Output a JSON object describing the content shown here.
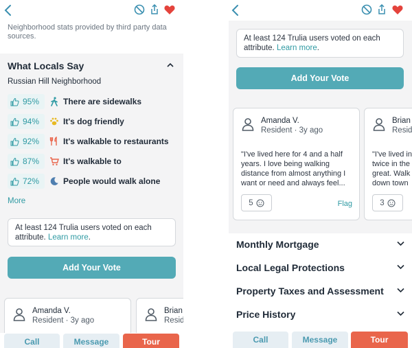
{
  "colors": {
    "teal": "#53aab6",
    "tour": "#e9654b",
    "heart": "#e4433c",
    "link": "#2f9aa3"
  },
  "left": {
    "header": {
      "back_icon": "chevron-left-icon",
      "icons": [
        "hide-icon",
        "share-icon",
        "heart-icon"
      ]
    },
    "stats_note": "Neighborhood stats provided by third party data sources.",
    "section_title": "What Locals Say",
    "neighborhood": "Russian Hill Neighborhood",
    "attributes": [
      {
        "percent": "95%",
        "label": "There are sidewalks",
        "icon": "walking-person-icon"
      },
      {
        "percent": "94%",
        "label": "It's dog friendly",
        "icon": "paw-icon"
      },
      {
        "percent": "92%",
        "label": "It's walkable to restaurants",
        "icon": "fork-knife-icon"
      },
      {
        "percent": "87%",
        "label": "It's walkable to",
        "icon": "shopping-cart-icon"
      },
      {
        "percent": "72%",
        "label": "People would walk alone",
        "icon": "moon-icon"
      }
    ],
    "more_label": "More",
    "vote_note": "At least 124 Trulia users voted on each attribute.",
    "learn_more": "Learn more",
    "vote_button": "Add Your Vote",
    "reviews": [
      {
        "name": "Amanda V.",
        "role": "Resident · 3y ago"
      },
      {
        "name": "Brian",
        "role": "Resid"
      }
    ],
    "bottom": {
      "call": "Call",
      "message": "Message",
      "tour": "Tour"
    }
  },
  "right": {
    "header": {
      "back_icon": "chevron-left-icon",
      "icons": [
        "hide-icon",
        "share-icon",
        "heart-icon"
      ]
    },
    "vote_note": "At least 124 Trulia users voted on each attribute.",
    "learn_more": "Learn more",
    "vote_button": "Add Your Vote",
    "reviews": [
      {
        "name": "Amanda V.",
        "role": "Resident · 3y ago",
        "quote": "\"I've lived here for 4 and a half years. I love being walking distance from almost anything I want or need and always feel...",
        "likes": "5",
        "flag": "Flag"
      },
      {
        "name": "Brian",
        "role": "Resid",
        "quote": "\"I've lived in twice in the great. Walk down town",
        "likes": "3"
      }
    ],
    "accordions": [
      "Monthly Mortgage",
      "Local Legal Protections",
      "Property Taxes and Assessment",
      "Price History"
    ],
    "bottom": {
      "call": "Call",
      "message": "Message",
      "tour": "Tour"
    }
  }
}
